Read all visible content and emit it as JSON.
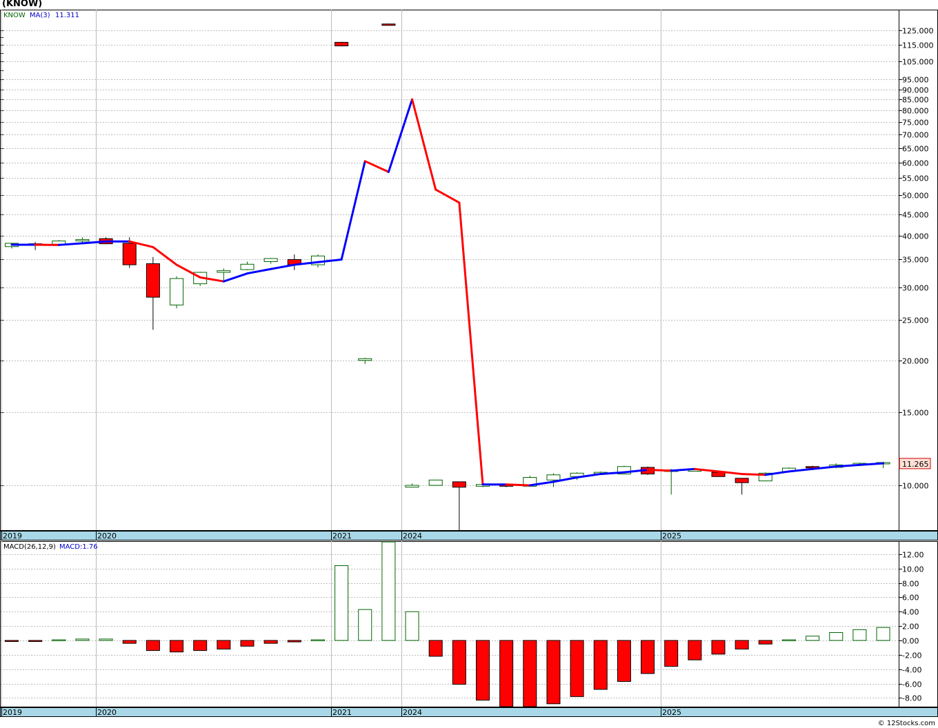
{
  "title": "(KNOW)",
  "credit": "© 12Stocks.com",
  "colors": {
    "up_candle": "#006400",
    "down_candle": "#ff0000",
    "ma_up": "#0000ff",
    "ma_down": "#ff0000",
    "axis_band": "#a8d8e8",
    "grid": "#bbbbbb"
  },
  "chart_data": [
    {
      "type": "candlestick",
      "legend": {
        "symbol": "KNOW",
        "ma_label": "MA(3)",
        "ma_value": "11.311"
      },
      "last_price": "11.265",
      "y_scale": "log",
      "ylim": [
        7.8,
        140
      ],
      "y_ticks": [
        10,
        15,
        20,
        25,
        30,
        35,
        40,
        45,
        50,
        55,
        60,
        65,
        70,
        75,
        80,
        85,
        90,
        95,
        105,
        115,
        125
      ],
      "y_tick_labels": [
        "10.000",
        "15.000",
        "20.000",
        "25.000",
        "30.000",
        "35.000",
        "40.000",
        "45.000",
        "50.000",
        "55.000",
        "60.000",
        "65.000",
        "70.000",
        "75.000",
        "80.000",
        "85.000",
        "90.000",
        "95.000",
        "105.000",
        "115.000",
        "125.000"
      ],
      "x_axis_labels": [
        {
          "label": "2019",
          "index": 0
        },
        {
          "label": "2020",
          "index": 4
        },
        {
          "label": "2021",
          "index": 14
        },
        {
          "label": "2024",
          "index": 17
        },
        {
          "label": "2025",
          "index": 28
        }
      ],
      "candles": [
        {
          "o": 37.6,
          "h": 38.4,
          "l": 37.2,
          "c": 38.3
        },
        {
          "o": 38.2,
          "h": 38.6,
          "l": 36.9,
          "c": 38.0
        },
        {
          "o": 38.1,
          "h": 39.0,
          "l": 37.8,
          "c": 38.8
        },
        {
          "o": 38.8,
          "h": 39.6,
          "l": 38.5,
          "c": 39.1
        },
        {
          "o": 39.3,
          "h": 39.6,
          "l": 38.1,
          "c": 38.2
        },
        {
          "o": 38.3,
          "h": 39.6,
          "l": 33.4,
          "c": 34.0
        },
        {
          "o": 34.2,
          "h": 35.5,
          "l": 23.7,
          "c": 28.4
        },
        {
          "o": 27.2,
          "h": 31.9,
          "l": 26.7,
          "c": 31.5
        },
        {
          "o": 30.6,
          "h": 32.7,
          "l": 30.2,
          "c": 32.6
        },
        {
          "o": 32.6,
          "h": 33.3,
          "l": 31.2,
          "c": 32.9
        },
        {
          "o": 33.1,
          "h": 34.6,
          "l": 33.0,
          "c": 34.1
        },
        {
          "o": 34.6,
          "h": 35.3,
          "l": 34.2,
          "c": 35.2
        },
        {
          "o": 35.0,
          "h": 36.0,
          "l": 33.0,
          "c": 34.0
        },
        {
          "o": 34.0,
          "h": 36.0,
          "l": 33.5,
          "c": 35.7
        },
        {
          "o": 116.8,
          "h": 117.1,
          "l": 114.2,
          "c": 114.5
        },
        {
          "o": 20.0,
          "h": 20.3,
          "l": 19.6,
          "c": 20.2
        },
        {
          "o": 129.3,
          "h": 129.6,
          "l": 128.5,
          "c": 128.6
        },
        {
          "o": 9.9,
          "h": 10.1,
          "l": 9.9,
          "c": 10.0
        },
        {
          "o": 10.0,
          "h": 10.3,
          "l": 10.0,
          "c": 10.3
        },
        {
          "o": 10.2,
          "h": 10.2,
          "l": 7.8,
          "c": 9.9
        },
        {
          "o": 9.95,
          "h": 10.2,
          "l": 9.9,
          "c": 10.05
        },
        {
          "o": 10.05,
          "h": 10.1,
          "l": 9.9,
          "c": 9.95
        },
        {
          "o": 9.95,
          "h": 10.55,
          "l": 9.95,
          "c": 10.45
        },
        {
          "o": 10.3,
          "h": 10.7,
          "l": 9.9,
          "c": 10.6
        },
        {
          "o": 10.5,
          "h": 10.75,
          "l": 10.3,
          "c": 10.7
        },
        {
          "o": 10.7,
          "h": 10.8,
          "l": 10.6,
          "c": 10.75
        },
        {
          "o": 10.65,
          "h": 11.15,
          "l": 10.65,
          "c": 11.1
        },
        {
          "o": 11.05,
          "h": 11.1,
          "l": 10.6,
          "c": 10.65
        },
        {
          "o": 10.8,
          "h": 10.95,
          "l": 9.5,
          "c": 10.9
        },
        {
          "o": 10.9,
          "h": 10.95,
          "l": 10.85,
          "c": 10.9
        },
        {
          "o": 10.75,
          "h": 10.75,
          "l": 10.5,
          "c": 10.5
        },
        {
          "o": 10.4,
          "h": 10.4,
          "l": 9.5,
          "c": 10.15
        },
        {
          "o": 10.25,
          "h": 10.75,
          "l": 10.25,
          "c": 10.7
        },
        {
          "o": 10.8,
          "h": 11.05,
          "l": 10.8,
          "c": 11.0
        },
        {
          "o": 11.1,
          "h": 11.15,
          "l": 11.0,
          "c": 11.05
        },
        {
          "o": 11.05,
          "h": 11.3,
          "l": 11.0,
          "c": 11.2
        },
        {
          "o": 11.2,
          "h": 11.35,
          "l": 11.2,
          "c": 11.3
        },
        {
          "o": 11.3,
          "h": 11.4,
          "l": 11.0,
          "c": 11.35
        }
      ],
      "ma": [
        38.0,
        38.0,
        37.95,
        38.3,
        38.7,
        38.7,
        37.5,
        34.0,
        31.7,
        31.0,
        32.4,
        33.2,
        34.0,
        34.5,
        35.0,
        60.4,
        56.9,
        85.1,
        51.6,
        48.0,
        10.05,
        10.05,
        10.0,
        10.2,
        10.45,
        10.65,
        10.75,
        10.9,
        10.85,
        10.95,
        10.8,
        10.65,
        10.6,
        10.8,
        10.95,
        11.1,
        11.2,
        11.3
      ],
      "ma_start_index": 0
    },
    {
      "type": "bar",
      "legend": {
        "label": "MACD(26,12,9)",
        "value_label": "MACD:1.76"
      },
      "ylim": [
        -9.2,
        13.8
      ],
      "y_ticks": [
        -8,
        -6,
        -4,
        -2,
        0,
        2,
        4,
        6,
        8,
        10,
        12
      ],
      "y_tick_labels": [
        "-8.00",
        "-6.00",
        "-4.00",
        "-2.00",
        "0.00",
        "2.00",
        "4.00",
        "6.00",
        "8.00",
        "10.00",
        "12.00"
      ],
      "x_axis_labels": [
        {
          "label": "2019",
          "index": 0
        },
        {
          "label": "2020",
          "index": 4
        },
        {
          "label": "2021",
          "index": 14
        },
        {
          "label": "2024",
          "index": 17
        },
        {
          "label": "2025",
          "index": 28
        }
      ],
      "values": [
        -0.1,
        -0.1,
        0.1,
        0.2,
        0.2,
        -0.4,
        -1.4,
        -1.6,
        -1.4,
        -1.2,
        -0.8,
        -0.4,
        -0.2,
        0.1,
        10.4,
        4.3,
        13.7,
        4.0,
        -2.2,
        -6.1,
        -8.3,
        -9.2,
        -9.2,
        -8.8,
        -7.8,
        -6.8,
        -5.7,
        -4.6,
        -3.6,
        -2.7,
        -1.9,
        -1.2,
        -0.5,
        0.1,
        0.6,
        1.1,
        1.5,
        1.8
      ]
    }
  ]
}
